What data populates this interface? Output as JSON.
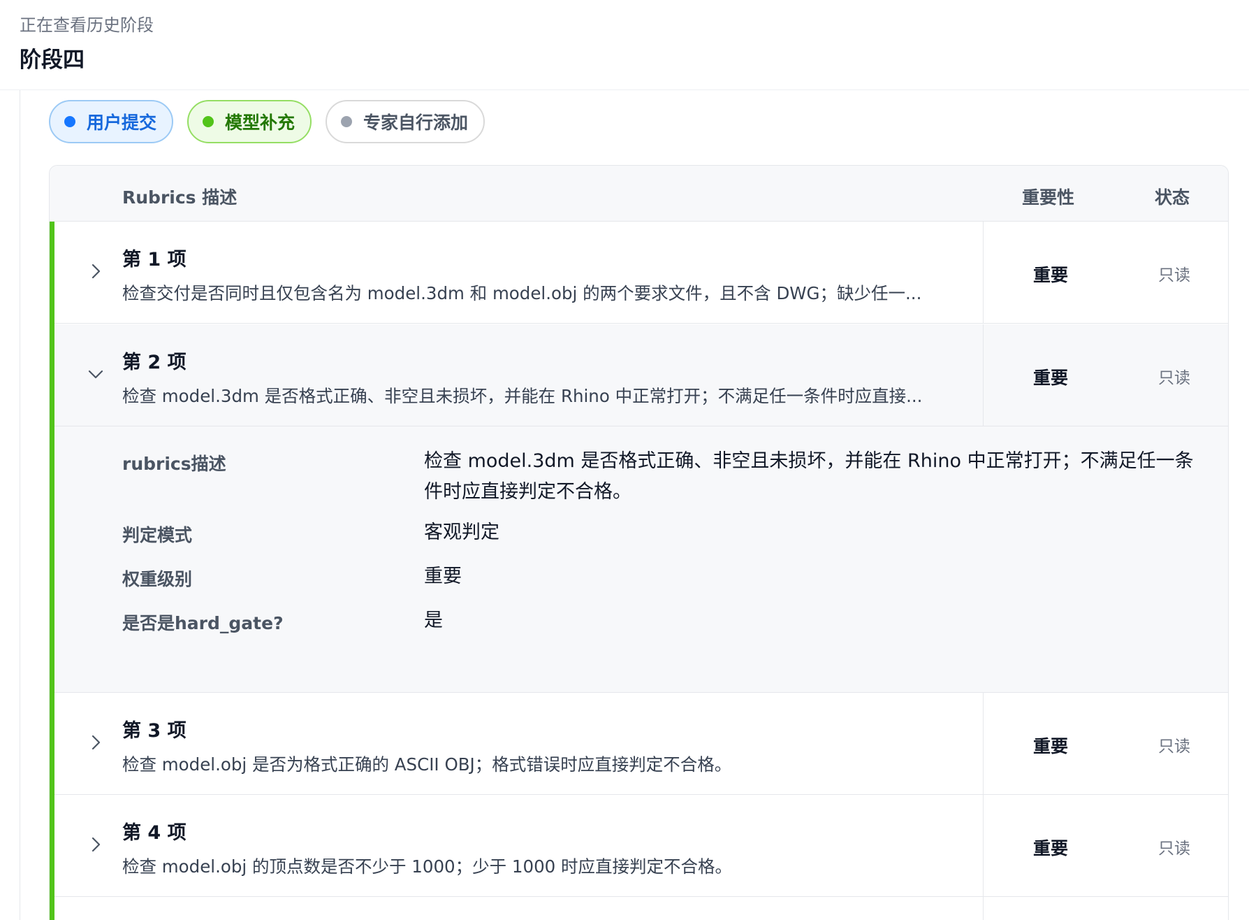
{
  "header": {
    "subtitle": "正在查看历史阶段",
    "title": "阶段四"
  },
  "chips": [
    {
      "label": "用户提交",
      "color": "#1677ff"
    },
    {
      "label": "模型补充",
      "color": "#52c41a"
    },
    {
      "label": "专家自行添加",
      "color": "#9ca3af"
    }
  ],
  "table": {
    "headers": {
      "description": "Rubrics 描述",
      "importance": "重要性",
      "status": "状态"
    },
    "rows": [
      {
        "title": "第 1 项",
        "description": "检查交付是否同时且仅包含名为 model.3dm 和 model.obj 的两个要求文件，且不含 DWG；缺少任一...",
        "importance": "重要",
        "status": "只读",
        "expanded": false
      },
      {
        "title": "第 2 项",
        "description": "检查 model.3dm 是否格式正确、非空且未损坏，并能在 Rhino 中正常打开；不满足任一条件时应直接...",
        "importance": "重要",
        "status": "只读",
        "expanded": true
      },
      {
        "title": "第 3 项",
        "description": "检查 model.obj 是否为格式正确的 ASCII OBJ；格式错误时应直接判定不合格。",
        "importance": "重要",
        "status": "只读",
        "expanded": false
      },
      {
        "title": "第 4 项",
        "description": "检查 model.obj 的顶点数是否不少于 1000；少于 1000 时应直接判定不合格。",
        "importance": "重要",
        "status": "只读",
        "expanded": false
      }
    ],
    "detail": {
      "rubric_label": "rubrics描述",
      "rubric_value": "检查 model.3dm 是否格式正确、非空且未损坏，并能在 Rhino 中正常打开；不满足任一条件时应直接判定不合格。",
      "mode_label": "判定模式",
      "mode_value": "客观判定",
      "weight_label": "权重级别",
      "weight_value": "重要",
      "hardgate_label": "是否是hard_gate?",
      "hardgate_value": "是"
    }
  },
  "colors": {
    "accent_green": "#52c41a",
    "accent_blue": "#1677ff"
  }
}
